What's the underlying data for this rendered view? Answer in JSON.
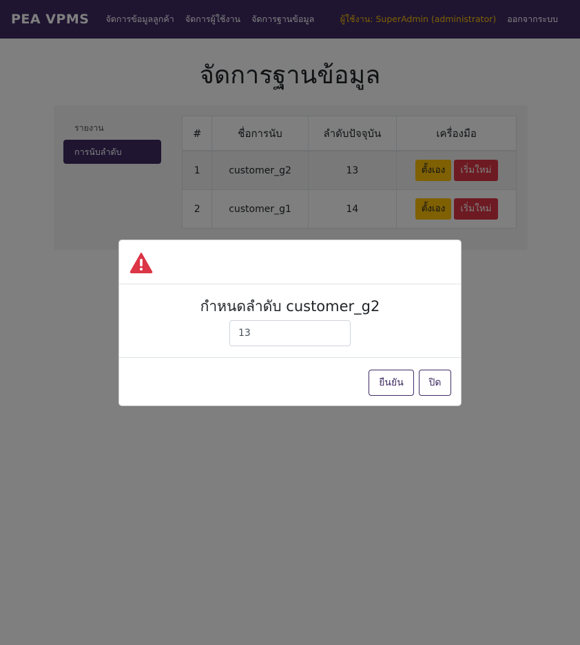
{
  "navbar": {
    "brand": "PEA VPMS",
    "links": [
      "จัดการข้อมูลลูกค้า",
      "จัดการผู้ใช้งาน",
      "จัดการฐานข้อมูล"
    ],
    "user_label": "ผู้ใช้งาน: SuperAdmin (administrator)",
    "logout": "ออกจากระบบ"
  },
  "page": {
    "title": "จัดการฐานข้อมูล"
  },
  "sidebar": {
    "items": [
      {
        "label": "รายงาน",
        "active": false
      },
      {
        "label": "การนับลำดับ",
        "active": true
      }
    ]
  },
  "table": {
    "headers": [
      "#",
      "ชื่อการนับ",
      "ลำดับปัจจุบัน",
      "เครื่องมือ"
    ],
    "rows": [
      {
        "index": "1",
        "name": "customer_g2",
        "current": "13"
      },
      {
        "index": "2",
        "name": "customer_g1",
        "current": "14"
      }
    ],
    "edit_label": "ตั้งเอง",
    "reset_label": "เริ่มใหม่"
  },
  "modal": {
    "icon": "warning-triangle-icon",
    "title": "กำหนดลำดับ customer_g2",
    "input_value": "13",
    "confirm_label": "ยืนยัน",
    "close_label": "ปิด"
  },
  "colors": {
    "primary": "#3f2b63",
    "warning": "#ffc107",
    "danger": "#dc3545"
  }
}
